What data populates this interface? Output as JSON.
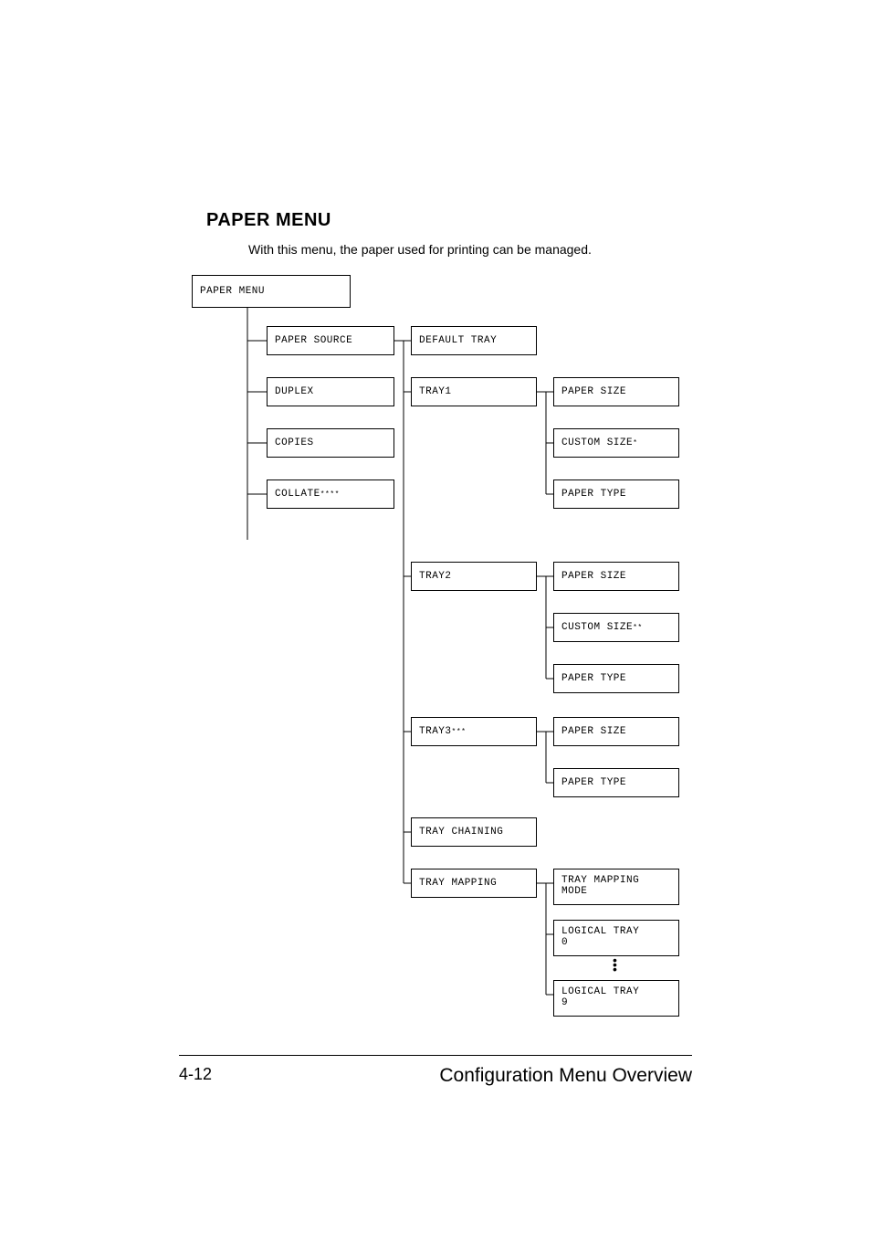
{
  "heading": "PAPER MENU",
  "sub": "With this menu, the paper used for printing can be managed.",
  "root": "PAPER MENU",
  "col1": {
    "paper_source": "PAPER SOURCE",
    "duplex": "DUPLEX",
    "copies": "COPIES",
    "collate": "COLLATE"
  },
  "collate_super": "****",
  "col2": {
    "default_tray": "DEFAULT TRAY",
    "tray1": "TRAY1",
    "tray2": "TRAY2",
    "tray3": "TRAY3",
    "tray_chaining": "TRAY CHAINING",
    "tray_mapping": "TRAY MAPPING"
  },
  "tray3_super": "***",
  "col3": {
    "paper_size": "PAPER SIZE",
    "custom_size": "CUSTOM SIZE",
    "paper_type": "PAPER TYPE",
    "tray_mapping_mode_l1": "TRAY MAPPING",
    "tray_mapping_mode_l2": "MODE",
    "logical_tray_l1": "LOGICAL TRAY",
    "logical_0": "0",
    "logical_9": "9"
  },
  "custom1_super": "*",
  "custom2_super": "**",
  "footer": {
    "page": "4-12",
    "title": "Configuration Menu Overview"
  }
}
